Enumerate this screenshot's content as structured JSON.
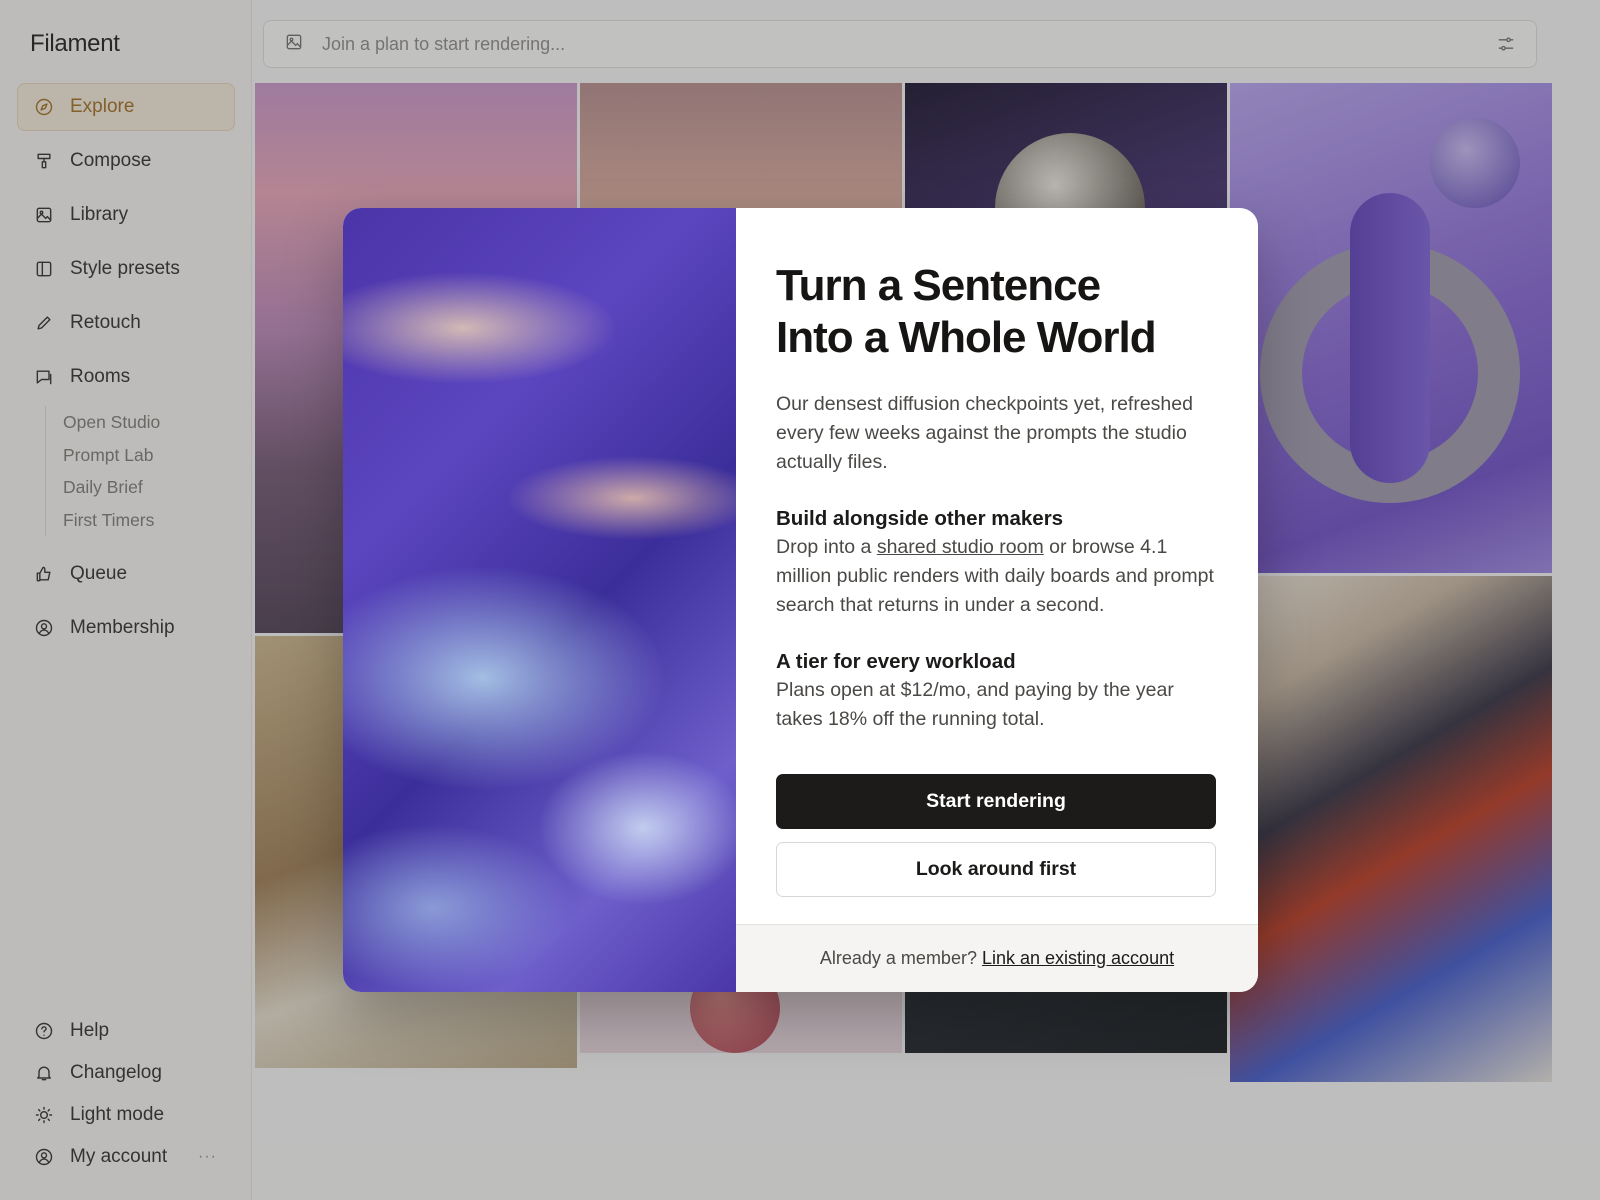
{
  "app": {
    "name": "Filament"
  },
  "sidebar": {
    "items": [
      {
        "label": "Explore",
        "icon": "compass-icon",
        "active": true
      },
      {
        "label": "Compose",
        "icon": "brush-icon"
      },
      {
        "label": "Library",
        "icon": "image-icon"
      },
      {
        "label": "Style presets",
        "icon": "columns-icon"
      },
      {
        "label": "Retouch",
        "icon": "pencil-icon"
      },
      {
        "label": "Rooms",
        "icon": "chat-icon"
      }
    ],
    "rooms": [
      "Open Studio",
      "Prompt Lab",
      "Daily Brief",
      "First Timers"
    ],
    "items2": [
      {
        "label": "Queue",
        "icon": "thumbs-up-icon"
      },
      {
        "label": "Membership",
        "icon": "user-circle-icon"
      }
    ],
    "bottom": [
      {
        "label": "Help",
        "icon": "help-icon"
      },
      {
        "label": "Changelog",
        "icon": "bell-icon"
      },
      {
        "label": "Light mode",
        "icon": "sun-icon"
      },
      {
        "label": "My account",
        "icon": "user-circle-icon"
      }
    ],
    "more": "···"
  },
  "search": {
    "placeholder": "Join a plan to start rendering..."
  },
  "modal": {
    "title_line1": "Turn a Sentence",
    "title_line2": "Into a Whole World",
    "intro": "Our densest diffusion checkpoints yet, refreshed every few weeks against the prompts the studio actually files.",
    "section1": {
      "heading": "Build alongside other makers",
      "before": "Drop into a ",
      "link": "shared studio room",
      "after": " or browse 4.1 million public renders with daily boards and prompt search that returns in under a second."
    },
    "section2": {
      "heading": "A tier for every workload",
      "body": "Plans open at $12/mo, and paying by the year takes 18% off the running total."
    },
    "primary_button": "Start rendering",
    "secondary_button": "Look around first",
    "footer_text": "Already a member?",
    "footer_link": "Link an existing account"
  },
  "colors": {
    "accent": "#a06a1e",
    "accent_bg": "#f3e9d9",
    "primary": "#1c1b1a"
  }
}
